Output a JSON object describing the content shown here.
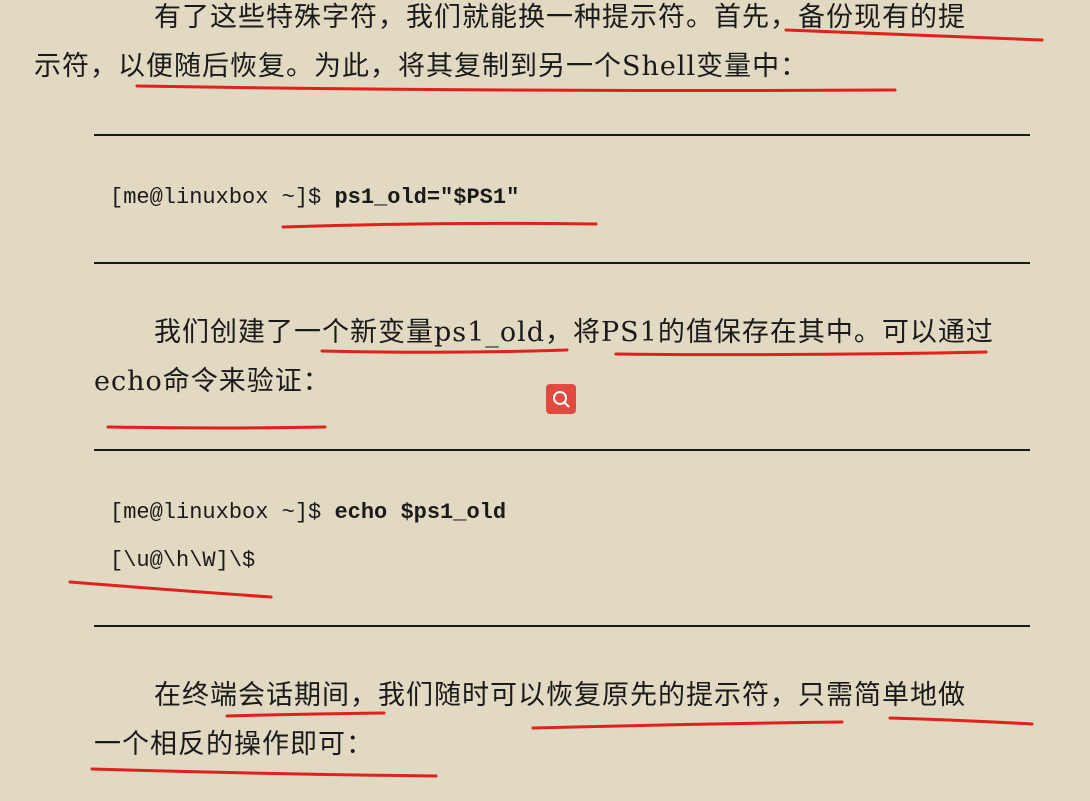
{
  "paragraphs": [
    {
      "lines": [
        "有了这些特殊字符，我们就能换一种提示符。首先，备份现有的提",
        "示符，以便随后恢复。为此，将其复制到另一个Shell变量中："
      ]
    },
    {
      "lines": [
        "我们创建了一个新变量ps1_old，将PS1的值保存在其中。可以通过",
        "echo命令来验证："
      ]
    },
    {
      "lines": [
        "在终端会话期间，我们随时可以恢复原先的提示符，只需简单地做",
        "一个相反的操作即可："
      ]
    }
  ],
  "code_blocks": [
    {
      "lines": [
        {
          "prompt": "[me@linuxbox ~]$ ",
          "command": "ps1_old=\"$PS1\""
        }
      ]
    },
    {
      "lines": [
        {
          "prompt": "[me@linuxbox ~]$ ",
          "command": "echo $ps1_old"
        },
        {
          "prompt": "[\\u@\\h\\W]\\$",
          "command": ""
        }
      ]
    }
  ],
  "search_button": {
    "icon": "search-icon",
    "color": "#e04a3f"
  },
  "annotation_color": "#e0211c",
  "background_color": "#e1d9c1"
}
